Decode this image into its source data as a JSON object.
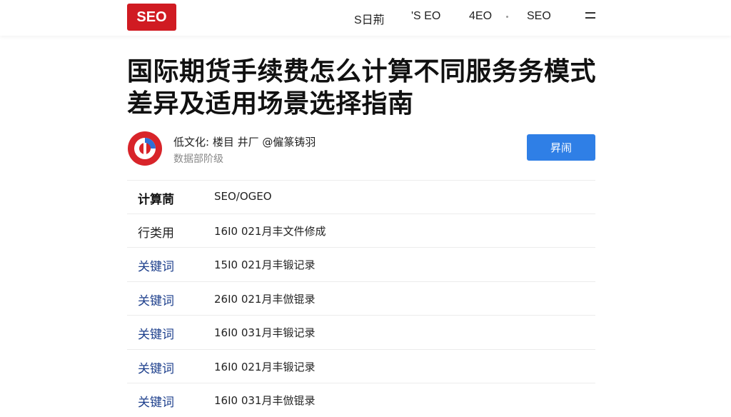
{
  "header": {
    "logo": "SEO",
    "nav": [
      "S日荊",
      "'S EO",
      "4EO",
      "SEO"
    ],
    "menu_icon": "hamburger-icon"
  },
  "article": {
    "title_line1": "国际期货手续费怎么计算不同服务务模式",
    "title_line2": "差异及适用场景选择指南"
  },
  "author": {
    "line1": "低文化: 楼目 井厂 @僱篆铸羽",
    "line2": "数据部阶级",
    "follow_label": "昇闹",
    "avatar_colors": [
      "#d8242a",
      "#2f6fd6"
    ]
  },
  "rows": [
    {
      "key": "计算茼",
      "value": "SEO/OGEO",
      "style": "bold"
    },
    {
      "key": "行类用",
      "value": "16I0 021月丰文件修成",
      "style": "dark"
    },
    {
      "key": "关键词",
      "value": "15I0 021月丰锻记录",
      "style": "link"
    },
    {
      "key": "关键词",
      "value": "26I0 021月丰倣锟录",
      "style": "link"
    },
    {
      "key": "关键词",
      "value": "16I0 031月丰锻记录",
      "style": "link"
    },
    {
      "key": "关键词",
      "value": "16I0 021月丰锻记录",
      "style": "link"
    },
    {
      "key": "关键词",
      "value": "16I0 031月丰倣锟录",
      "style": "link"
    }
  ]
}
